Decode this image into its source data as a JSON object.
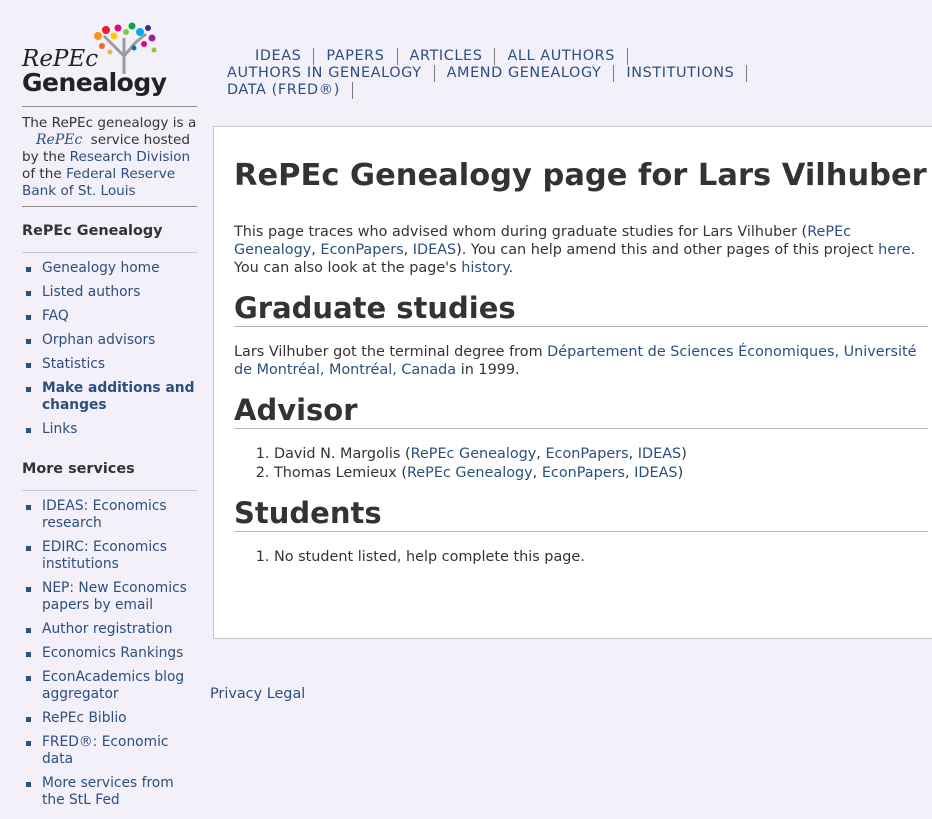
{
  "sidebar": {
    "logo": {
      "line1": "RePEc",
      "line2": "Genealogy"
    },
    "blurb": {
      "t1": "The RePEc genealogy is a ",
      "mini_logo": "RePEc",
      "t2": " service hosted by the ",
      "link1": "Research Division",
      "t3": " of the ",
      "link2": "Federal Reserve Bank of St. Louis"
    },
    "section1_title": "RePEc Genealogy",
    "section1_items": [
      "Genealogy home",
      "Listed authors",
      "FAQ",
      "Orphan advisors",
      "Statistics",
      "Make additions and changes",
      "Links"
    ],
    "section2_title": "More services",
    "section2_items": [
      "IDEAS: Economics research",
      "EDIRC: Economics institutions",
      "NEP: New Economics papers by email",
      "Author registration",
      "Economics Rankings",
      "EconAcademics blog aggregator",
      "RePEc Biblio",
      "FRED®: Economic data",
      "More services from the StL Fed"
    ]
  },
  "nav": {
    "row1": [
      "IDEAS",
      "PAPERS",
      "ARTICLES",
      "ALL AUTHORS"
    ],
    "row2": [
      "AUTHORS IN GENEALOGY",
      "AMEND GENEALOGY",
      "INSTITUTIONS"
    ],
    "row3": [
      "DATA (FRED®)"
    ]
  },
  "main": {
    "title": "RePEc Genealogy page for Lars Vilhuber",
    "intro": {
      "t1": "This page traces who advised whom during graduate studies for Lars Vilhuber (",
      "l1": "RePEc Genealogy",
      "s1": ", ",
      "l2": "EconPapers",
      "s2": ", ",
      "l3": "IDEAS",
      "t2": "). You can help amend this and other pages of this project ",
      "l4": "here",
      "t3": ". You can also look at the page's ",
      "l5": "history",
      "t4": "."
    },
    "grad_heading": "Graduate studies",
    "grad": {
      "t1": "Lars Vilhuber got the terminal degree from ",
      "link": "Département de Sciences Économiques, Université de Montréal, Montréal, Canada",
      "t2": " in 1999."
    },
    "advisor_heading": "Advisor",
    "advisors": [
      {
        "name": "David N. Margolis",
        "links": [
          "RePEc Genealogy",
          "EconPapers",
          "IDEAS"
        ]
      },
      {
        "name": "Thomas Lemieux",
        "links": [
          "RePEc Genealogy",
          "EconPapers",
          "IDEAS"
        ]
      }
    ],
    "students_heading": "Students",
    "students_text": "No student listed, help complete this page."
  },
  "footer": {
    "privacy": "Privacy",
    "legal": "Legal"
  }
}
